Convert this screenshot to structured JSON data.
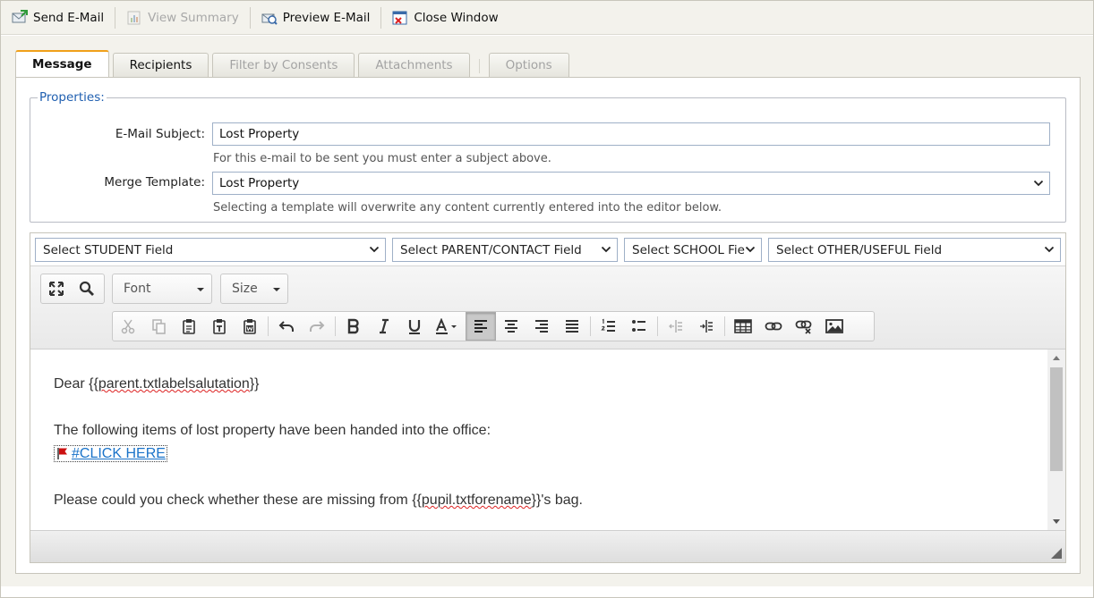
{
  "toolbar": {
    "send": "Send E-Mail",
    "view_summary": "View Summary",
    "preview": "Preview E-Mail",
    "close": "Close Window"
  },
  "tabs": [
    {
      "label": "Message",
      "state": "active"
    },
    {
      "label": "Recipients",
      "state": "enabled"
    },
    {
      "label": "Filter by Consents",
      "state": "disabled"
    },
    {
      "label": "Attachments",
      "state": "disabled"
    },
    {
      "label": "Options",
      "state": "disabled"
    }
  ],
  "properties": {
    "legend": "Properties:",
    "subject_label": "E-Mail Subject:",
    "subject_value": "Lost Property",
    "subject_hint": "For this e-mail to be sent you must enter a subject above.",
    "template_label": "Merge Template:",
    "template_value": "Lost Property",
    "template_hint": "Selecting a template will overwrite any content currently entered into the editor below."
  },
  "merge_fields": {
    "student": "Select STUDENT Field",
    "parent": "Select PARENT/CONTACT Field",
    "school": "Select SCHOOL Field",
    "other": "Select OTHER/USEFUL Field"
  },
  "editor_toolbar": {
    "font": "Font",
    "size": "Size"
  },
  "content": {
    "greeting_pre": "Dear {{",
    "greeting_field": "parent.txtlabelsalutation",
    "greeting_post": "}}",
    "line1": "The following items of lost property have been handed into the office:",
    "link": "#CLICK HERE",
    "line2_pre": "Please could you check whether these are missing from {{",
    "line2_field": "pupil.txtforename",
    "line2_post": "}}'s bag."
  },
  "colors": {
    "accent_tab": "#f0a019",
    "legend": "#1f5fb0",
    "link": "#1a73c9"
  }
}
